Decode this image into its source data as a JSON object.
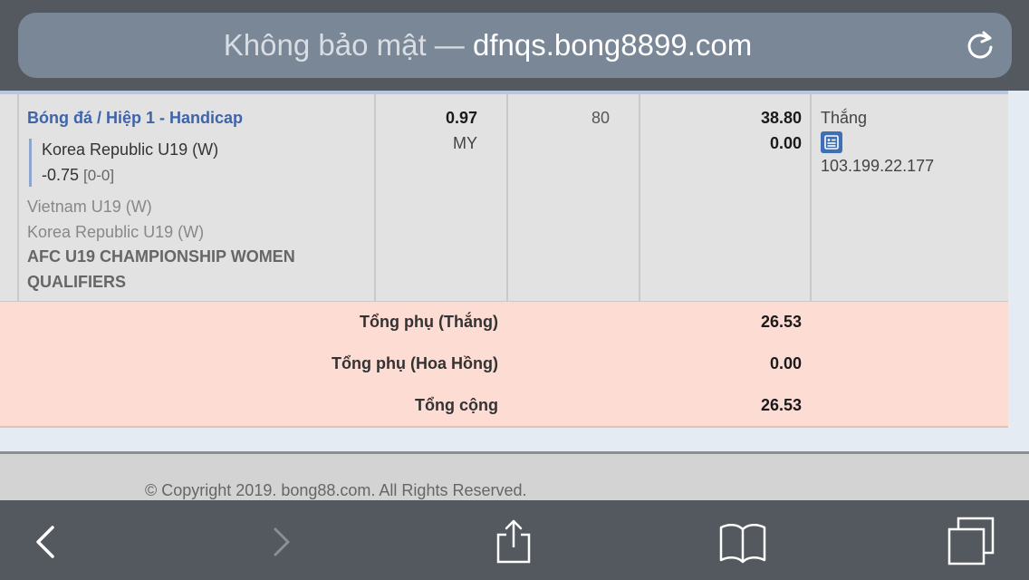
{
  "browser": {
    "url_prefix": "Không bảo mật — ",
    "url_domain": "dfnqs.bong8899.com"
  },
  "bet": {
    "type_label": "Bóng đá / Hiệp 1 - Handicap",
    "selection_team": "Korea Republic U19 (W)",
    "handicap": "-0.75",
    "score": "[0-0]",
    "home_team": "Vietnam U19 (W)",
    "away_team": "Korea Republic U19 (W)",
    "league": "AFC U19 CHAMPIONSHIP WOMEN QUALIFIERS",
    "odds": "0.97",
    "odds_type": "MY",
    "stake": "80",
    "win_amount": "38.80",
    "commission": "0.00",
    "status": "Thắng",
    "ip": "103.199.22.177"
  },
  "totals": {
    "rows": [
      {
        "label": "Tổng phụ (Thắng)",
        "value": "26.53"
      },
      {
        "label": "Tổng phụ (Hoa Hồng)",
        "value": "0.00"
      },
      {
        "label": "Tổng cộng",
        "value": "26.53"
      }
    ]
  },
  "footer": {
    "copyright": "© Copyright 2019. bong88.com. All Rights Reserved."
  },
  "toolbar": {
    "icons": [
      "back-icon",
      "forward-icon",
      "share-icon",
      "bookmarks-icon",
      "tabs-icon"
    ]
  },
  "colors": {
    "link_blue": "#3f64a8",
    "totals_bg": "#fddcd3",
    "row_bg": "#e2e2e2",
    "chrome_bg": "#54595f"
  }
}
